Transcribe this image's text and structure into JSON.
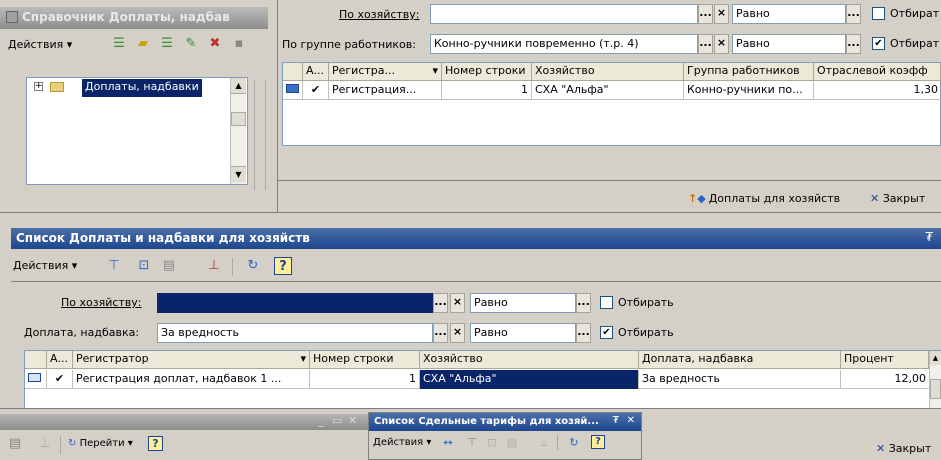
{
  "top_left_window": {
    "title": "Справочник Доплаты, надбав",
    "actions_label": "Действия",
    "tree_item": "Доплаты, надбавки"
  },
  "top_right_form": {
    "filter1_label": "По хозяйству:",
    "filter1_value": "",
    "filter1_cond": "Равно",
    "filter1_check_label": "Отбират",
    "filter2_label": "По группе работников:",
    "filter2_value": "Конно-ручники повременно (т.р. 4)",
    "filter2_cond": "Равно",
    "filter2_check_label": "Отбират",
    "table_headers": [
      "А...",
      "Регистра...",
      "Номер строки",
      "Хозяйство",
      "Группа работников",
      "Отраслевой коэфф"
    ],
    "table_row": [
      "✔",
      "Регистрация...",
      "1",
      "СХА \"Альфа\"",
      "Конно-ручники по...",
      "1,30"
    ],
    "bottom_btn1": "Доплаты для хозяйств",
    "bottom_btn2": "Закрыт"
  },
  "main_window": {
    "title": "Список Доплаты и надбавки для хозяйств",
    "actions_label": "Действия",
    "filter1_label": "По хозяйству:",
    "filter1_value": "",
    "filter1_cond": "Равно",
    "filter1_check_label": "Отбирать",
    "filter1_checked": false,
    "filter2_label": "Доплата, надбавка:",
    "filter2_value": "За вредность",
    "filter2_cond": "Равно",
    "filter2_check_label": "Отбирать",
    "filter2_checked": true,
    "table_headers": [
      "А...",
      "Регистратор",
      "Номер строки",
      "Хозяйство",
      "Доплата, надбавка",
      "Процент"
    ],
    "table_row": [
      "✔",
      "Регистрация доплат, надбавок 1 ...",
      "1",
      "СХА \"Альфа\"",
      "За вредность",
      "12,00"
    ]
  },
  "bottom_bar": {
    "goto_label": "Перейти",
    "close_label": "Закрыт",
    "mini_window_title": "Список Сдельные тарифы для хозяй...",
    "mini_actions_label": "Действия"
  },
  "colors": {
    "selection": "#0a246a",
    "title_blue": "#1e4690"
  }
}
